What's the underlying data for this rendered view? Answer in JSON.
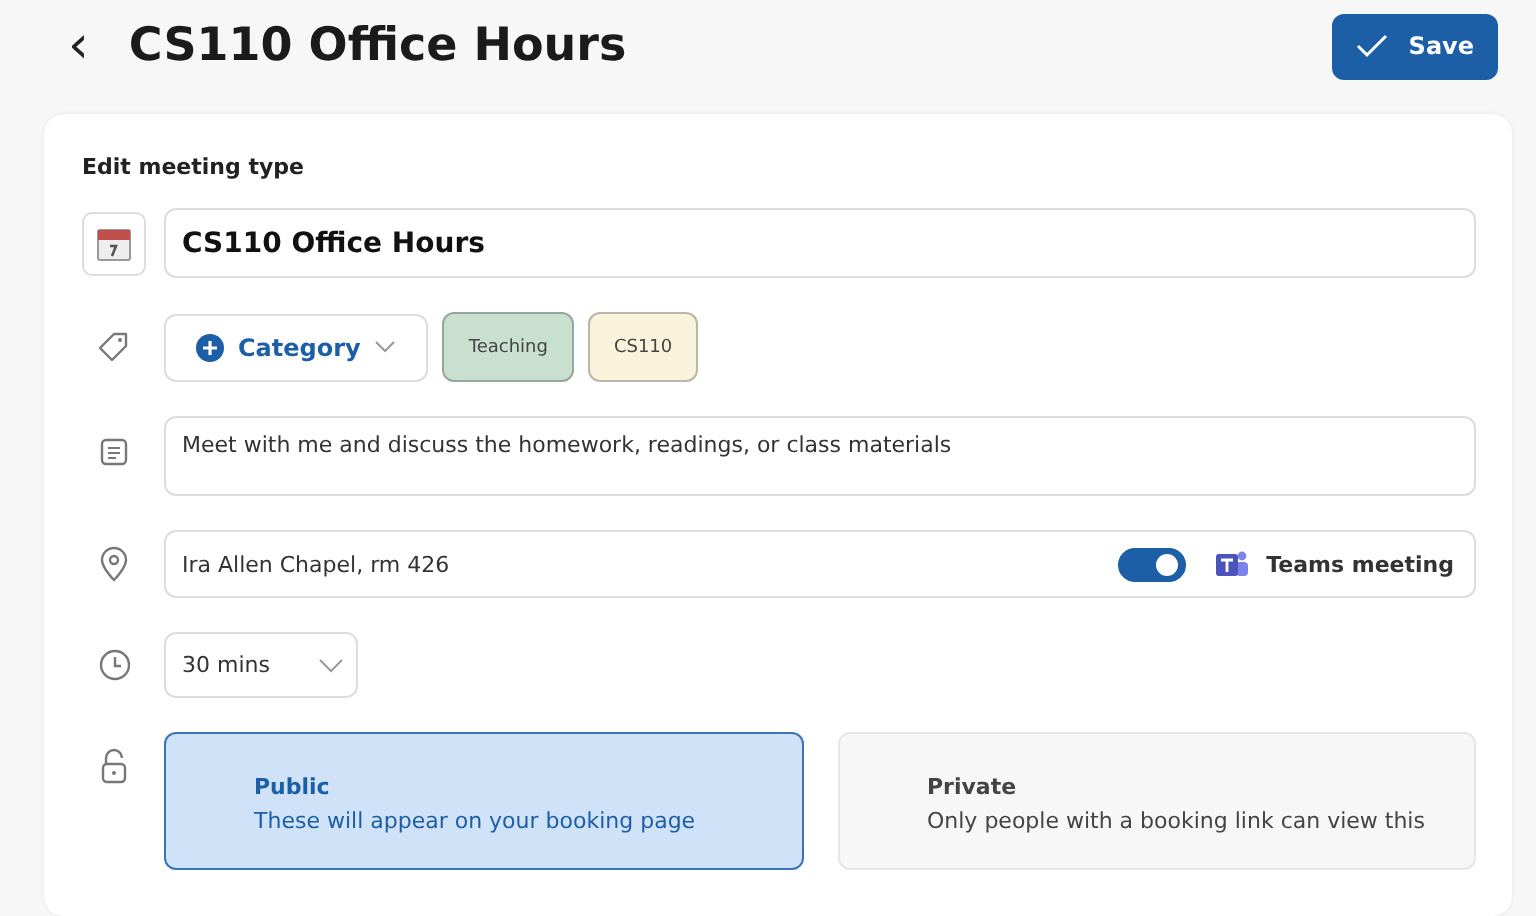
{
  "header": {
    "back": "‹",
    "title": "CS110 Office Hours",
    "save": "Save"
  },
  "card": {
    "heading": "Edit meeting type",
    "title_value": "CS110 Office Hours",
    "category": {
      "label": "Category",
      "tags": [
        {
          "label": "Teaching",
          "color": "#c9dfd0"
        },
        {
          "label": "CS110",
          "color": "#faf3dc"
        }
      ]
    },
    "description": "Meet with me and discuss the homework, readings, or class materials",
    "location": {
      "value": "Ira Allen Chapel, rm 426",
      "teams_on": true,
      "teams_label": "Teams meeting"
    },
    "duration": "30 mins",
    "visibility": [
      {
        "title": "Public",
        "text": "These will appear on your booking page",
        "selected": true
      },
      {
        "title": "Private",
        "text": "Only people with a booking link can view this",
        "selected": false
      }
    ]
  }
}
